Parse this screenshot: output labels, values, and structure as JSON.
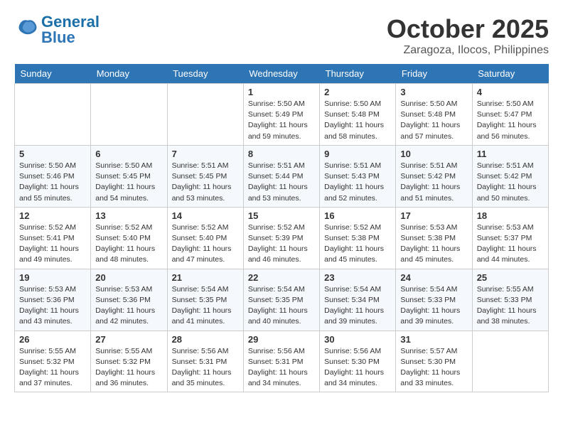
{
  "header": {
    "logo_general": "General",
    "logo_blue": "Blue",
    "month_title": "October 2025",
    "location": "Zaragoza, Ilocos, Philippines"
  },
  "weekdays": [
    "Sunday",
    "Monday",
    "Tuesday",
    "Wednesday",
    "Thursday",
    "Friday",
    "Saturday"
  ],
  "weeks": [
    [
      {
        "day": "",
        "info": ""
      },
      {
        "day": "",
        "info": ""
      },
      {
        "day": "",
        "info": ""
      },
      {
        "day": "1",
        "info": "Sunrise: 5:50 AM\nSunset: 5:49 PM\nDaylight: 11 hours\nand 59 minutes."
      },
      {
        "day": "2",
        "info": "Sunrise: 5:50 AM\nSunset: 5:48 PM\nDaylight: 11 hours\nand 58 minutes."
      },
      {
        "day": "3",
        "info": "Sunrise: 5:50 AM\nSunset: 5:48 PM\nDaylight: 11 hours\nand 57 minutes."
      },
      {
        "day": "4",
        "info": "Sunrise: 5:50 AM\nSunset: 5:47 PM\nDaylight: 11 hours\nand 56 minutes."
      }
    ],
    [
      {
        "day": "5",
        "info": "Sunrise: 5:50 AM\nSunset: 5:46 PM\nDaylight: 11 hours\nand 55 minutes."
      },
      {
        "day": "6",
        "info": "Sunrise: 5:50 AM\nSunset: 5:45 PM\nDaylight: 11 hours\nand 54 minutes."
      },
      {
        "day": "7",
        "info": "Sunrise: 5:51 AM\nSunset: 5:45 PM\nDaylight: 11 hours\nand 53 minutes."
      },
      {
        "day": "8",
        "info": "Sunrise: 5:51 AM\nSunset: 5:44 PM\nDaylight: 11 hours\nand 53 minutes."
      },
      {
        "day": "9",
        "info": "Sunrise: 5:51 AM\nSunset: 5:43 PM\nDaylight: 11 hours\nand 52 minutes."
      },
      {
        "day": "10",
        "info": "Sunrise: 5:51 AM\nSunset: 5:42 PM\nDaylight: 11 hours\nand 51 minutes."
      },
      {
        "day": "11",
        "info": "Sunrise: 5:51 AM\nSunset: 5:42 PM\nDaylight: 11 hours\nand 50 minutes."
      }
    ],
    [
      {
        "day": "12",
        "info": "Sunrise: 5:52 AM\nSunset: 5:41 PM\nDaylight: 11 hours\nand 49 minutes."
      },
      {
        "day": "13",
        "info": "Sunrise: 5:52 AM\nSunset: 5:40 PM\nDaylight: 11 hours\nand 48 minutes."
      },
      {
        "day": "14",
        "info": "Sunrise: 5:52 AM\nSunset: 5:40 PM\nDaylight: 11 hours\nand 47 minutes."
      },
      {
        "day": "15",
        "info": "Sunrise: 5:52 AM\nSunset: 5:39 PM\nDaylight: 11 hours\nand 46 minutes."
      },
      {
        "day": "16",
        "info": "Sunrise: 5:52 AM\nSunset: 5:38 PM\nDaylight: 11 hours\nand 45 minutes."
      },
      {
        "day": "17",
        "info": "Sunrise: 5:53 AM\nSunset: 5:38 PM\nDaylight: 11 hours\nand 45 minutes."
      },
      {
        "day": "18",
        "info": "Sunrise: 5:53 AM\nSunset: 5:37 PM\nDaylight: 11 hours\nand 44 minutes."
      }
    ],
    [
      {
        "day": "19",
        "info": "Sunrise: 5:53 AM\nSunset: 5:36 PM\nDaylight: 11 hours\nand 43 minutes."
      },
      {
        "day": "20",
        "info": "Sunrise: 5:53 AM\nSunset: 5:36 PM\nDaylight: 11 hours\nand 42 minutes."
      },
      {
        "day": "21",
        "info": "Sunrise: 5:54 AM\nSunset: 5:35 PM\nDaylight: 11 hours\nand 41 minutes."
      },
      {
        "day": "22",
        "info": "Sunrise: 5:54 AM\nSunset: 5:35 PM\nDaylight: 11 hours\nand 40 minutes."
      },
      {
        "day": "23",
        "info": "Sunrise: 5:54 AM\nSunset: 5:34 PM\nDaylight: 11 hours\nand 39 minutes."
      },
      {
        "day": "24",
        "info": "Sunrise: 5:54 AM\nSunset: 5:33 PM\nDaylight: 11 hours\nand 39 minutes."
      },
      {
        "day": "25",
        "info": "Sunrise: 5:55 AM\nSunset: 5:33 PM\nDaylight: 11 hours\nand 38 minutes."
      }
    ],
    [
      {
        "day": "26",
        "info": "Sunrise: 5:55 AM\nSunset: 5:32 PM\nDaylight: 11 hours\nand 37 minutes."
      },
      {
        "day": "27",
        "info": "Sunrise: 5:55 AM\nSunset: 5:32 PM\nDaylight: 11 hours\nand 36 minutes."
      },
      {
        "day": "28",
        "info": "Sunrise: 5:56 AM\nSunset: 5:31 PM\nDaylight: 11 hours\nand 35 minutes."
      },
      {
        "day": "29",
        "info": "Sunrise: 5:56 AM\nSunset: 5:31 PM\nDaylight: 11 hours\nand 34 minutes."
      },
      {
        "day": "30",
        "info": "Sunrise: 5:56 AM\nSunset: 5:30 PM\nDaylight: 11 hours\nand 34 minutes."
      },
      {
        "day": "31",
        "info": "Sunrise: 5:57 AM\nSunset: 5:30 PM\nDaylight: 11 hours\nand 33 minutes."
      },
      {
        "day": "",
        "info": ""
      }
    ]
  ]
}
